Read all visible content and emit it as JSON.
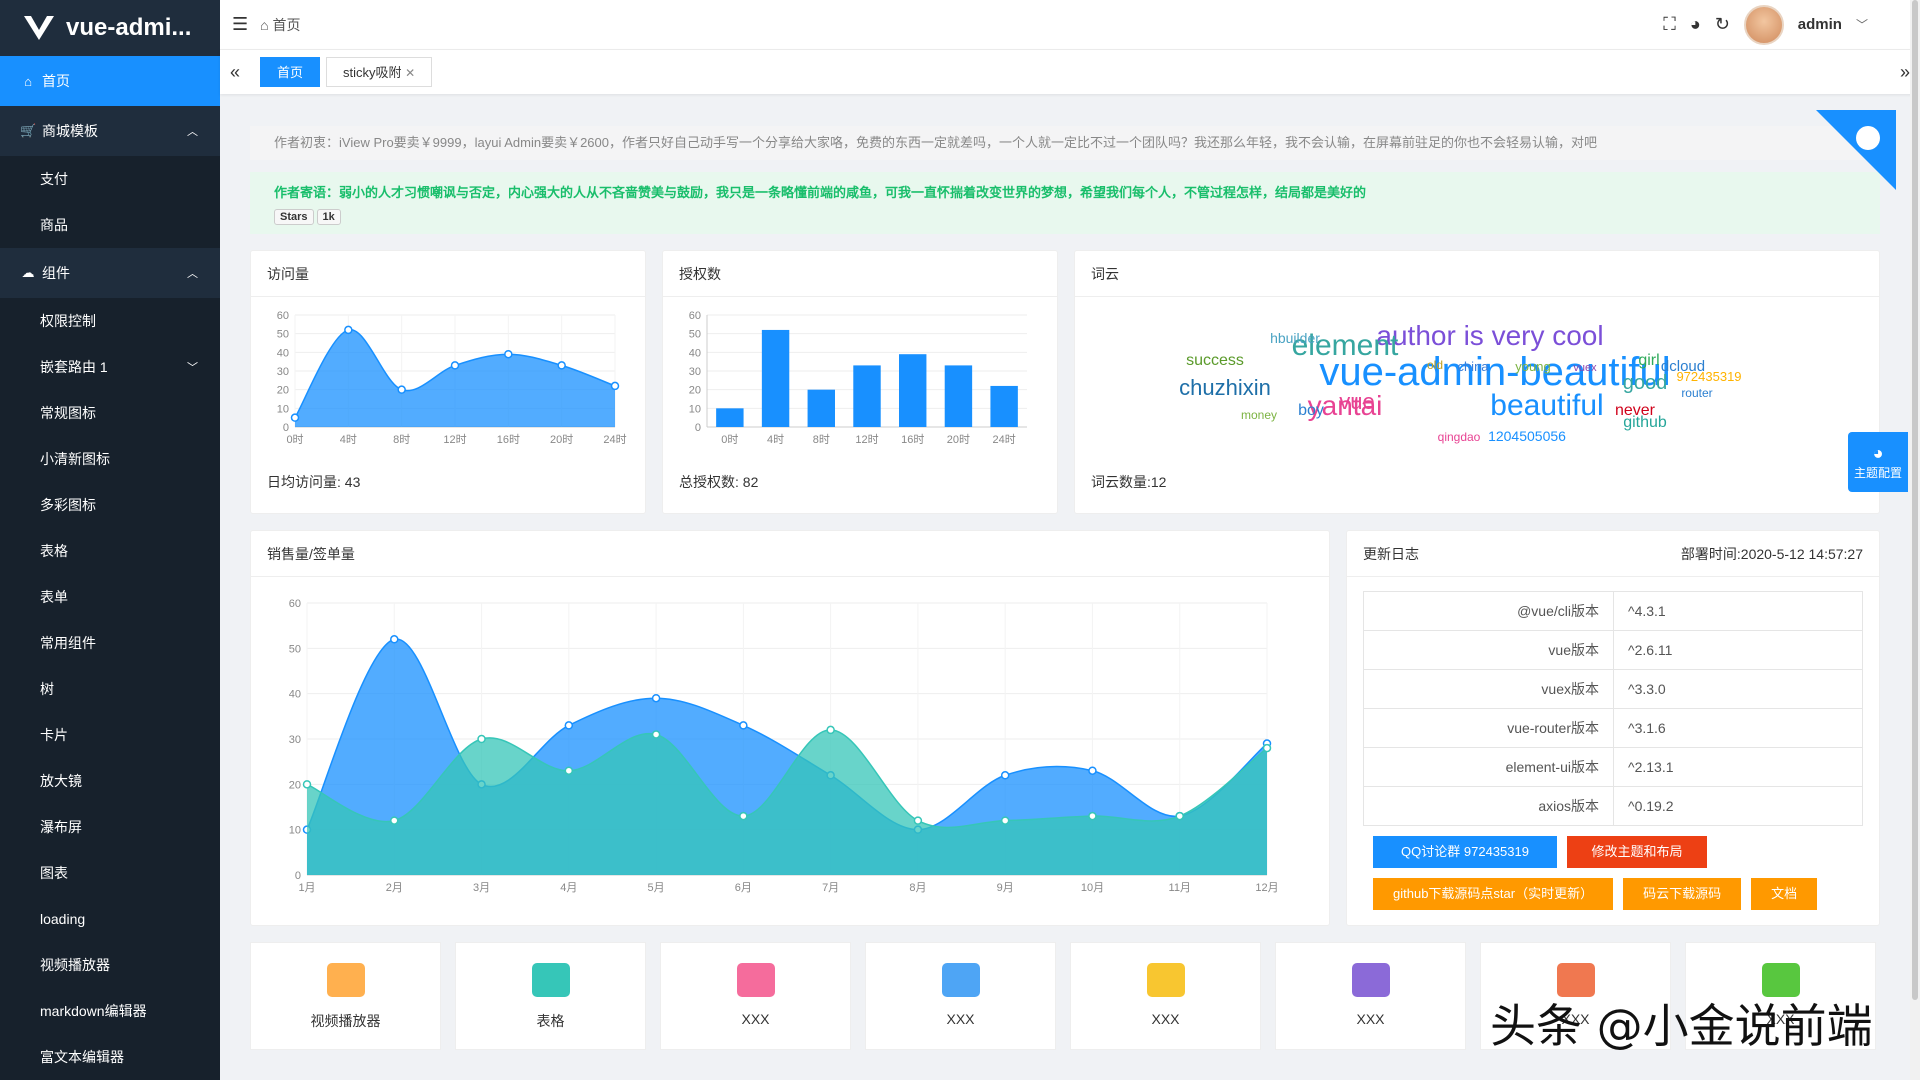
{
  "app": {
    "title": "vue-admi...",
    "user": "admin"
  },
  "breadcrumb": {
    "home": "首页"
  },
  "tabs": [
    {
      "label": "首页"
    },
    {
      "label": "sticky吸附"
    }
  ],
  "sidebar": {
    "items": [
      {
        "label": "首页"
      },
      {
        "label": "商城模板"
      },
      {
        "label": "支付"
      },
      {
        "label": "商品"
      },
      {
        "label": "组件"
      },
      {
        "label": "权限控制"
      },
      {
        "label": "嵌套路由 1"
      },
      {
        "label": "常规图标"
      },
      {
        "label": "小清新图标"
      },
      {
        "label": "多彩图标"
      },
      {
        "label": "表格"
      },
      {
        "label": "表单"
      },
      {
        "label": "常用组件"
      },
      {
        "label": "树"
      },
      {
        "label": "卡片"
      },
      {
        "label": "放大镜"
      },
      {
        "label": "瀑布屏"
      },
      {
        "label": "图表"
      },
      {
        "label": "loading"
      },
      {
        "label": "视频播放器"
      },
      {
        "label": "markdown编辑器"
      },
      {
        "label": "富文本编辑器"
      }
    ]
  },
  "notices": {
    "intro": "作者初衷：iView Pro要卖￥9999，layui Admin要卖￥2600，作者只好自己动手写一个分享给大家咯，免费的东西一定就差吗，一个人就一定比不过一个团队吗？我还那么年轻，我不会认输，在屏幕前驻足的你也不会轻易认输，对吧",
    "message": "作者寄语：弱小的人才习惯嘲讽与否定，内心强大的人从不吝啬赞美与鼓励，我只是一条略懂前端的咸鱼，可我一直怀揣着改变世界的梦想，希望我们每个人，不管过程怎样，结局都是美好的",
    "stars_label": "Stars",
    "stars_count": "1k"
  },
  "cards": {
    "visits": {
      "title": "访问量",
      "footer": "日均访问量: 43"
    },
    "auth": {
      "title": "授权数",
      "footer": "总授权数: 82"
    },
    "cloud": {
      "title": "词云",
      "footer": "词云数量:12"
    },
    "sales": {
      "title": "销售量/签单量"
    },
    "log": {
      "title": "更新日志",
      "deploy": "部署时间:2020-5-12 14:57:27"
    }
  },
  "versions": [
    {
      "k": "@vue/cli版本",
      "v": "^4.3.1"
    },
    {
      "k": "vue版本",
      "v": "^2.6.11"
    },
    {
      "k": "vuex版本",
      "v": "^3.3.0"
    },
    {
      "k": "vue-router版本",
      "v": "^3.1.6"
    },
    {
      "k": "element-ui版本",
      "v": "^2.13.1"
    },
    {
      "k": "axios版本",
      "v": "^0.19.2"
    }
  ],
  "buttons": {
    "qq": "QQ讨论群 972435319",
    "theme": "修改主题和布局",
    "github": "github下载源码点star（实时更新）",
    "gitee": "码云下载源码",
    "docs": "文档"
  },
  "tiles": [
    {
      "label": "视频播放器",
      "color": "#ffb04f"
    },
    {
      "label": "表格",
      "color": "#36c6b8"
    },
    {
      "label": "XXX",
      "color": "#f56c9c"
    },
    {
      "label": "XXX",
      "color": "#4ea5f5"
    },
    {
      "label": "XXX",
      "color": "#f8c630"
    },
    {
      "label": "XXX",
      "color": "#8b6ad8"
    },
    {
      "label": "XXX",
      "color": "#f07850"
    },
    {
      "label": "XXX",
      "color": "#58c73f"
    }
  ],
  "theme_config": "主题配置",
  "watermark": "头条 @小金说前端",
  "wordcloud": [
    {
      "t": "vue-admin-beautiful",
      "c": "#1890ff",
      "s": 40
    },
    {
      "t": "author is very cool",
      "c": "#7b4fd8",
      "s": 28
    },
    {
      "t": "element",
      "c": "#36a6a0",
      "s": 30
    },
    {
      "t": "beautiful",
      "c": "#1890ff",
      "s": 30
    },
    {
      "t": "yantai",
      "c": "#e84393",
      "s": 28
    },
    {
      "t": "chuzhixin",
      "c": "#1e6fa8",
      "s": 22
    },
    {
      "t": "vue",
      "c": "#e84393",
      "s": 22
    },
    {
      "t": "good",
      "c": "#36a6a0",
      "s": 20
    },
    {
      "t": "success",
      "c": "#5a9a2a",
      "s": 16
    },
    {
      "t": "never",
      "c": "#d0021b",
      "s": 16
    },
    {
      "t": "boy",
      "c": "#2b7fd0",
      "s": 16
    },
    {
      "t": "github",
      "c": "#26a69a",
      "s": 16
    },
    {
      "t": "girl",
      "c": "#2eaa5a",
      "s": 16
    },
    {
      "t": "dcloud",
      "c": "#2b7fd0",
      "s": 15
    },
    {
      "t": "1204505056",
      "c": "#1890ff",
      "s": 14
    },
    {
      "t": "hbuilder",
      "c": "#4aa3c3",
      "s": 14
    },
    {
      "t": "china",
      "c": "#3b7dd8",
      "s": 13
    },
    {
      "t": "young",
      "c": "#7cb342",
      "s": 13
    },
    {
      "t": "972435319",
      "c": "#ffb300",
      "s": 13
    },
    {
      "t": "old",
      "c": "#c0a020",
      "s": 12
    },
    {
      "t": "vuex",
      "c": "#8e44ad",
      "s": 11
    },
    {
      "t": "router",
      "c": "#2b7fd0",
      "s": 12
    },
    {
      "t": "money",
      "c": "#7cb342",
      "s": 12
    },
    {
      "t": "qingdao",
      "c": "#e84393",
      "s": 12
    }
  ],
  "chart_data": [
    {
      "type": "area",
      "title": "访问量",
      "categories": [
        "0时",
        "4时",
        "8时",
        "12时",
        "16时",
        "20时",
        "24时"
      ],
      "values": [
        5,
        52,
        20,
        33,
        39,
        33,
        22
      ],
      "ylim": [
        0,
        60
      ],
      "yticks": [
        0,
        10,
        20,
        30,
        40,
        50,
        60
      ],
      "color": "#1890ff"
    },
    {
      "type": "bar",
      "title": "授权数",
      "categories": [
        "0时",
        "4时",
        "8时",
        "12时",
        "16时",
        "20时",
        "24时"
      ],
      "values": [
        10,
        52,
        20,
        33,
        39,
        33,
        22
      ],
      "ylim": [
        0,
        60
      ],
      "yticks": [
        0,
        10,
        20,
        30,
        40,
        50,
        60
      ],
      "color": "#1890ff"
    },
    {
      "type": "area",
      "title": "销售量/签单量",
      "categories": [
        "1月",
        "2月",
        "3月",
        "4月",
        "5月",
        "6月",
        "7月",
        "8月",
        "9月",
        "10月",
        "11月",
        "12月"
      ],
      "ylim": [
        0,
        60
      ],
      "yticks": [
        0,
        10,
        20,
        30,
        40,
        50,
        60
      ],
      "series": [
        {
          "values": [
            10,
            52,
            20,
            33,
            39,
            33,
            22,
            10,
            22,
            23,
            13,
            29
          ],
          "color": "#1890ff"
        },
        {
          "values": [
            20,
            12,
            30,
            23,
            31,
            13,
            32,
            12,
            12,
            13,
            13,
            28
          ],
          "color": "#36c6b8"
        }
      ]
    }
  ]
}
